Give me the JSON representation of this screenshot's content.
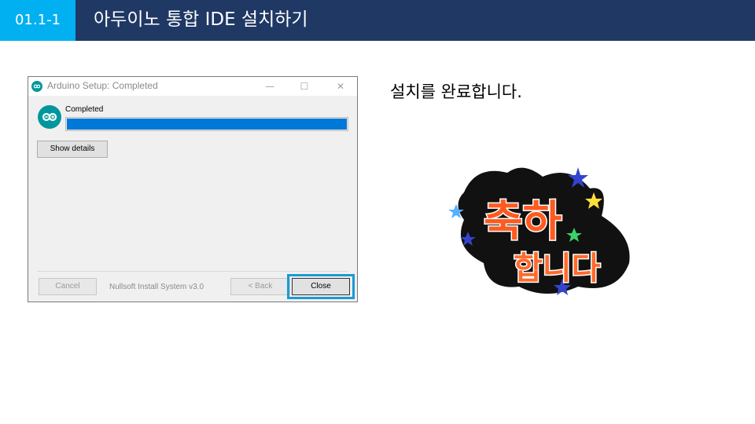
{
  "header": {
    "section_number": "01.1-1",
    "title": "아두이노 통합 IDE 설치하기"
  },
  "dialog": {
    "window_title": "Arduino Setup: Completed",
    "status_label": "Completed",
    "progress_percent": 100,
    "show_details_label": "Show details",
    "cancel_label": "Cancel",
    "installer_name": "Nullsoft Install System v3.0",
    "back_label": "< Back",
    "close_label": "Close",
    "window_controls": {
      "minimize": "—",
      "maximize": "☐",
      "close": "✕"
    }
  },
  "instruction_text": "설치를 완료합니다.",
  "congrats_image": {
    "line1": "축하",
    "line2": "합니다"
  },
  "colors": {
    "header_bg": "#1f3864",
    "section_tag_bg": "#00b0f0",
    "progress_fill": "#0078d7",
    "highlight_border": "#1b9ad6",
    "arduino_teal": "#00979c"
  }
}
